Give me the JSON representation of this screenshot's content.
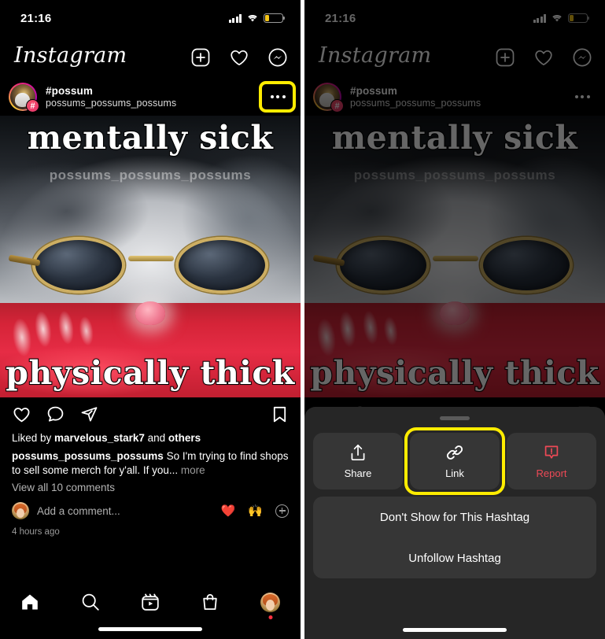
{
  "status_bar": {
    "time": "21:16",
    "signal_icon": "cellular-signal-icon",
    "wifi_icon": "wifi-icon",
    "battery_icon": "battery-low-icon",
    "battery_level_pct": 22
  },
  "app_header": {
    "logo_text": "Instagram",
    "icons": [
      {
        "name": "add-post-icon",
        "label": "Add post"
      },
      {
        "name": "activity-heart-icon",
        "label": "Activity"
      },
      {
        "name": "messenger-icon",
        "label": "Messenger"
      }
    ]
  },
  "post": {
    "hashtag_title": "#possum",
    "username": "possums_possums_possums",
    "avatar_badge": "#",
    "more_button_label": "...",
    "media": {
      "top_text": "mentally sick",
      "bottom_text": "physically thick",
      "watermark": "possums_possums_possums"
    },
    "actions": [
      {
        "name": "like-icon",
        "label": "Like"
      },
      {
        "name": "comment-icon",
        "label": "Comment"
      },
      {
        "name": "share-post-icon",
        "label": "Share"
      },
      {
        "name": "bookmark-icon",
        "label": "Save"
      }
    ],
    "likes_prefix": "Liked by ",
    "likes_user": "marvelous_stark7",
    "likes_middle": " and ",
    "likes_suffix": "others",
    "caption_author": "possums_possums_possums",
    "caption_text": " So I'm trying to find shops to sell some merch for y'all. If you...",
    "caption_more": " more",
    "view_comments": "View all 10 comments",
    "comment_placeholder": "Add a comment...",
    "quick_reactions": [
      "❤️",
      "🙌"
    ],
    "add_reaction_icon": "plus-circle-icon",
    "timestamp": "4 hours ago"
  },
  "tab_bar": {
    "tabs": [
      {
        "name": "tab-home",
        "label": "Home"
      },
      {
        "name": "tab-search",
        "label": "Search"
      },
      {
        "name": "tab-reels",
        "label": "Reels"
      },
      {
        "name": "tab-shop",
        "label": "Shop"
      },
      {
        "name": "tab-profile",
        "label": "Profile"
      }
    ]
  },
  "action_sheet": {
    "buttons": [
      {
        "name": "share-sheet-button",
        "label": "Share",
        "icon": "share-upload-icon",
        "highlighted": false
      },
      {
        "name": "link-sheet-button",
        "label": "Link",
        "icon": "chain-link-icon",
        "highlighted": true
      },
      {
        "name": "report-sheet-button",
        "label": "Report",
        "icon": "report-warning-icon",
        "highlighted": false
      }
    ],
    "items": [
      {
        "name": "dont-show-hashtag-item",
        "label": "Don't Show for This Hashtag"
      },
      {
        "name": "unfollow-hashtag-item",
        "label": "Unfollow Hashtag"
      }
    ]
  },
  "highlight_color": "#ffec00",
  "accent_colors": {
    "report_red": "#ED4956",
    "notification_red": "#FF3040",
    "battery_yellow": "#F5C518"
  }
}
